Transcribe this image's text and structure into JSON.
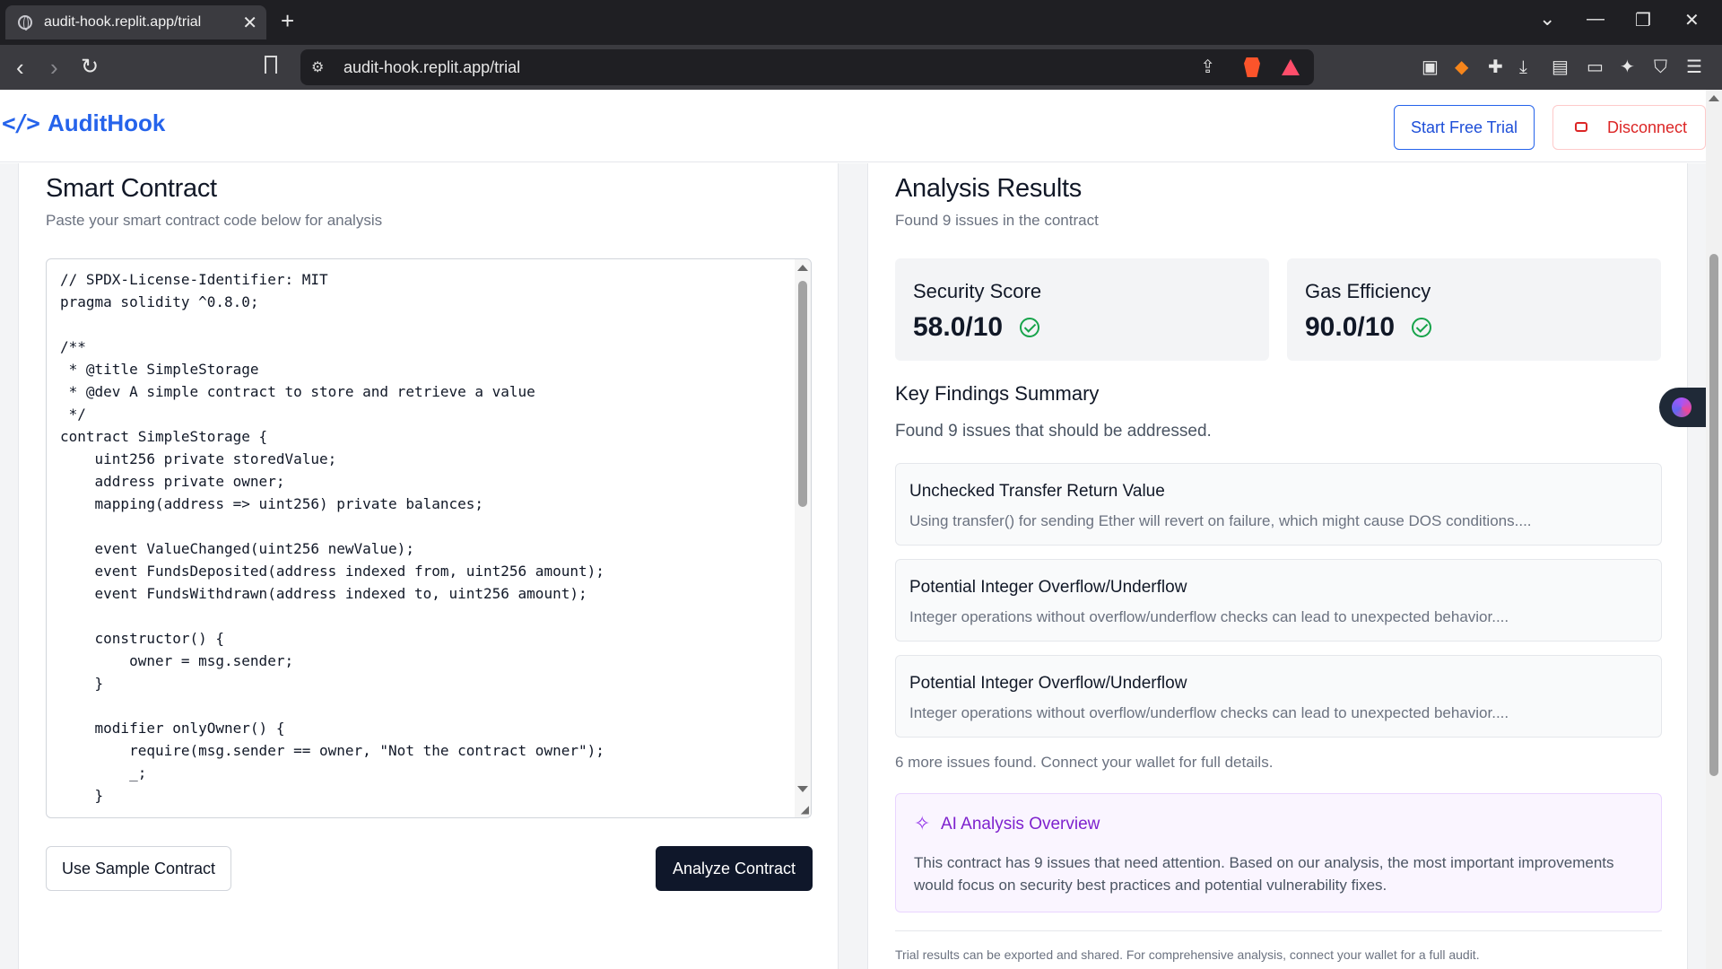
{
  "browser": {
    "tab_title": "audit-hook.replit.app/trial",
    "tab_close": "✕",
    "new_tab": "+",
    "url": "audit-hook.replit.app/trial",
    "controls": {
      "dropdown": "⌄",
      "minimize": "—",
      "restore": "❐",
      "close": "✕"
    },
    "nav": {
      "back": "‹",
      "forward": "›",
      "reload": "↻"
    }
  },
  "header": {
    "logo_icon": "</>",
    "logo_text": "AuditHook",
    "trial_button": "Start Free Trial",
    "disconnect_button": "Disconnect"
  },
  "contract": {
    "title": "Smart Contract",
    "subtitle": "Paste your smart contract code below for analysis",
    "code": "// SPDX-License-Identifier: MIT\npragma solidity ^0.8.0;\n\n/**\n * @title SimpleStorage\n * @dev A simple contract to store and retrieve a value\n */\ncontract SimpleStorage {\n    uint256 private storedValue;\n    address private owner;\n    mapping(address => uint256) private balances;\n\n    event ValueChanged(uint256 newValue);\n    event FundsDeposited(address indexed from, uint256 amount);\n    event FundsWithdrawn(address indexed to, uint256 amount);\n\n    constructor() {\n        owner = msg.sender;\n    }\n\n    modifier onlyOwner() {\n        require(msg.sender == owner, \"Not the contract owner\");\n        _;\n    }",
    "sample_button": "Use Sample Contract",
    "analyze_button": "Analyze Contract"
  },
  "results": {
    "title": "Analysis Results",
    "subtitle": "Found 9 issues in the contract",
    "security_label": "Security Score",
    "security_value": "58.0/10",
    "gas_label": "Gas Efficiency",
    "gas_value": "90.0/10",
    "summary_title": "Key Findings Summary",
    "summary_sub": "Found 9 issues that should be addressed.",
    "findings": [
      {
        "title": "Unchecked Transfer Return Value",
        "desc": "Using transfer() for sending Ether will revert on failure, which might cause DOS conditions...."
      },
      {
        "title": "Potential Integer Overflow/Underflow",
        "desc": "Integer operations without overflow/underflow checks can lead to unexpected behavior...."
      },
      {
        "title": "Potential Integer Overflow/Underflow",
        "desc": "Integer operations without overflow/underflow checks can lead to unexpected behavior...."
      }
    ],
    "more": "6 more issues found. Connect your wallet for full details.",
    "ai_title": "AI Analysis Overview",
    "ai_desc": "This contract has 9 issues that need attention. Based on our analysis, the most important improvements would focus on security best practices and potential vulnerability fixes.",
    "footer": "Trial results can be exported and shared. For comprehensive analysis, connect your wallet for a full audit."
  },
  "icons": {
    "sparkle": "✧",
    "share": "⇪",
    "site_settings": "⚙"
  },
  "colors": {
    "brand": "#2563eb",
    "danger": "#dc2626",
    "success": "#16a34a",
    "ai_accent": "#7e22ce",
    "primary_button": "#0f172a"
  }
}
